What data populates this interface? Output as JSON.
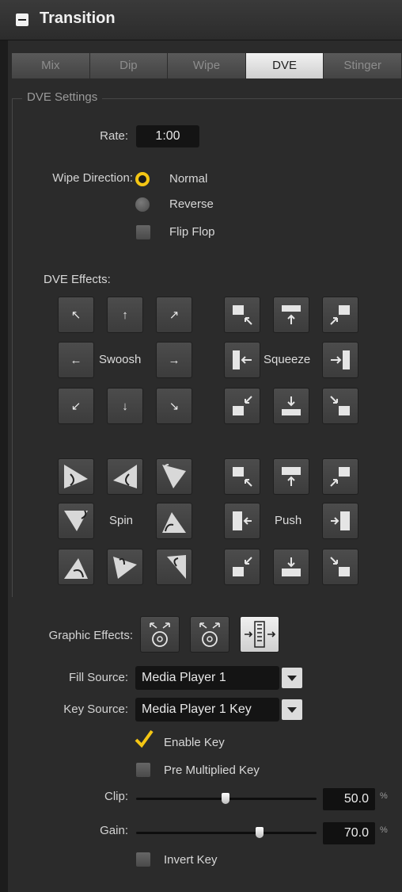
{
  "header": {
    "title": "Transition"
  },
  "tabs": [
    "Mix",
    "Dip",
    "Wipe",
    "DVE",
    "Stinger"
  ],
  "active_tab": "DVE",
  "dve_settings": {
    "group_title": "DVE Settings",
    "rate_label": "Rate:",
    "rate_value": "1:00",
    "wipe_direction_label": "Wipe Direction:",
    "normal_label": "Normal",
    "reverse_label": "Reverse",
    "flip_flop_label": "Flip Flop",
    "dve_effects_label": "DVE Effects:",
    "swoosh_label": "Swoosh",
    "squeeze_label": "Squeeze",
    "spin_label": "Spin",
    "push_label": "Push",
    "swoosh_arrows": [
      "↖",
      "↑",
      "↗",
      "←",
      "→",
      "↙",
      "↓",
      "↘"
    ]
  },
  "graphic": {
    "graphic_effects_label": "Graphic Effects:",
    "fill_source_label": "Fill Source:",
    "fill_source_value": "Media Player 1",
    "key_source_label": "Key Source:",
    "key_source_value": "Media Player 1 Key",
    "enable_key_label": "Enable Key",
    "pre_multiplied_label": "Pre Multiplied Key",
    "clip_label": "Clip:",
    "clip_value": "50.0",
    "gain_label": "Gain:",
    "gain_value": "70.0",
    "percent_sign": "%",
    "invert_key_label": "Invert Key"
  },
  "colors": {
    "accent": "#f4c614",
    "panel": "#2b2b2b"
  }
}
